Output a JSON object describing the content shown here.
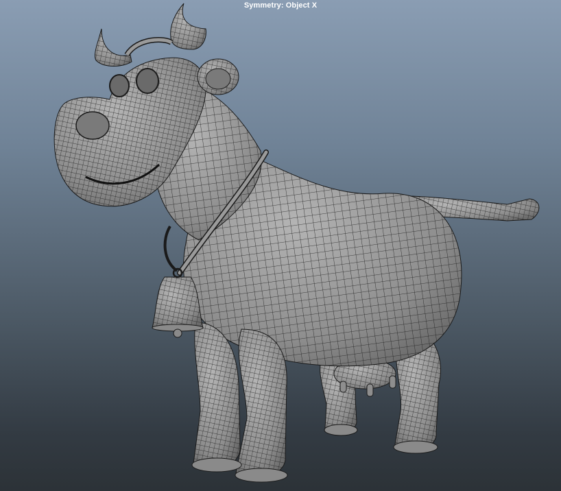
{
  "viewport": {
    "hud_text": "Symmetry: Object X",
    "model_name": "cow-wireframe-model",
    "shading": "wireframe-on-shaded",
    "colors": {
      "bg_top": "#8a9db3",
      "bg_bottom": "#2c3237",
      "surface": "#9a9a9a",
      "wire": "#1a1a1a",
      "hud_text": "#ffffff"
    }
  }
}
